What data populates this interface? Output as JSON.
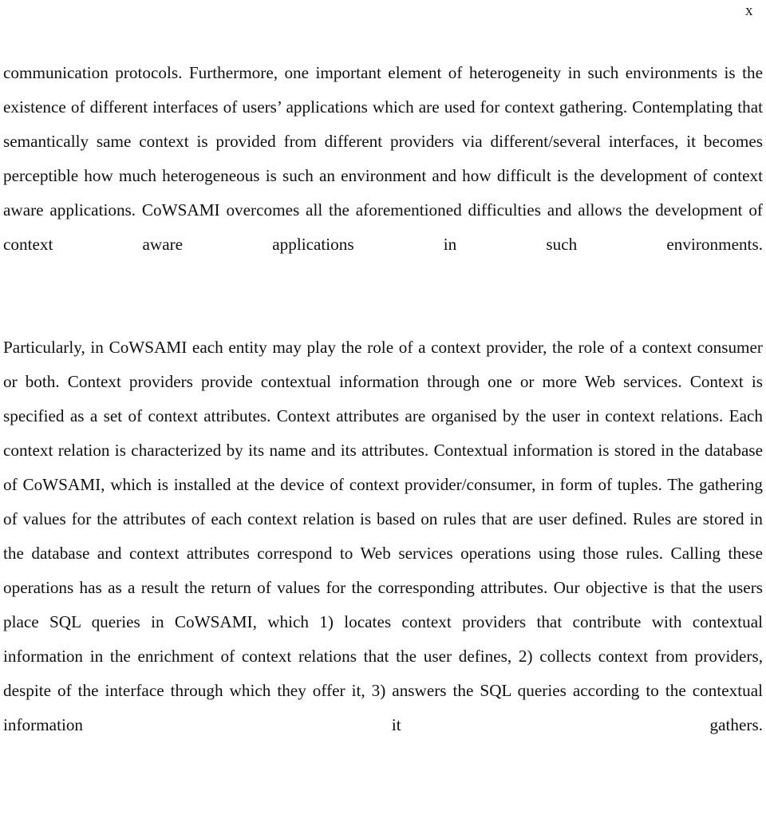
{
  "page": {
    "number_label": "x",
    "background_color": "#ffffff",
    "text_color": "#111111"
  },
  "document": {
    "paragraphs": [
      {
        "id": "para-heterogeneity",
        "text": "communication protocols. Furthermore, one important element of heterogeneity in such environments is the existence of different interfaces of users’ applications which are used for context gathering. Contemplating that semantically same context is provided from different providers via different/several interfaces, it becomes perceptible how much heterogeneous is such an environment and how difficult is the development of context aware applications. CoWSAMI overcomes all the aforementioned difficulties and allows the development of context aware applications in such environments."
      },
      {
        "id": "para-cowsami-roles",
        "text": "Particularly, in CoWSAMI each entity may play the role of a context provider, the role of a context consumer or both. Context providers provide contextual information through one or more Web services. Context is specified as a set of context attributes. Context attributes are organised by the user in context relations. Each context relation is characterized by its name and its attributes. Contextual information is stored in the database of CoWSAMI, which is installed at the device of context provider/consumer, in form of tuples. The gathering of values for the attributes of each context relation is based on rules that are user defined. Rules are stored in the database and context attributes correspond to Web services operations using those rules.  Calling these operations has as a result the return of values for the corresponding attributes. Our objective is that the users place SQL queries in CoWSAMI, which 1) locates context providers that contribute with contextual information in the enrichment of context relations that the user defines, 2) collects context from providers, despite of the interface through which they offer it, 3) answers the SQL queries according to the contextual information it gathers."
      }
    ]
  }
}
